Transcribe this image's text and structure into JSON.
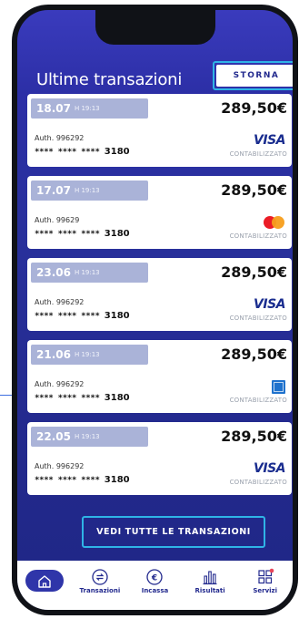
{
  "header": {
    "title": "Ultime transazioni",
    "storna_label": "STORNA"
  },
  "transactions": [
    {
      "date": "18.07",
      "time": "H 19:13",
      "amount": "289,50€",
      "auth": "Auth. 996292",
      "card_mask": "**** **** ****",
      "card_last": "3180",
      "brand": "VISA",
      "brand_icon": "visa-logo",
      "status": "CONTABILIZZATO"
    },
    {
      "date": "17.07",
      "time": "H 19:13",
      "amount": "289,50€",
      "auth": "Auth. 99629",
      "card_mask": "**** **** ****",
      "card_last": "3180",
      "brand": "",
      "brand_icon": "mastercard-logo",
      "status": "CONTABILIZZATO"
    },
    {
      "date": "23.06",
      "time": "H 19:13",
      "amount": "289,50€",
      "auth": "Auth. 996292",
      "card_mask": "**** **** ****",
      "card_last": "3180",
      "brand": "VISA",
      "brand_icon": "visa-logo",
      "status": "CONTABILIZZATO"
    },
    {
      "date": "21.06",
      "time": "H 19:13",
      "amount": "289,50€",
      "auth": "Auth. 996292",
      "card_mask": "**** **** ****",
      "card_last": "3180",
      "brand": "",
      "brand_icon": "amex-logo",
      "status": "CONTABILIZZATO"
    },
    {
      "date": "22.05",
      "time": "H 19:13",
      "amount": "289,50€",
      "auth": "Auth. 996292",
      "card_mask": "**** **** ****",
      "card_last": "3180",
      "brand": "VISA",
      "brand_icon": "visa-logo",
      "status": "CONTABILIZZATO"
    }
  ],
  "all_transactions_label": "VEDI TUTTE LE TRANSAZIONI",
  "tabbar": {
    "items": [
      {
        "label": "",
        "icon": "home-icon",
        "active": true
      },
      {
        "label": "Transazioni",
        "icon": "transactions-icon"
      },
      {
        "label": "Incassa",
        "icon": "euro-icon"
      },
      {
        "label": "Risultati",
        "icon": "bar-chart-icon"
      },
      {
        "label": "Servizi",
        "icon": "grid-icon",
        "badge": true
      }
    ]
  },
  "colors": {
    "background": "#232a8e",
    "accent_border": "#2fb4e6",
    "date_pill": "#aab3d8",
    "visa_blue": "#1a2d8f",
    "badge": "#e8455a"
  }
}
